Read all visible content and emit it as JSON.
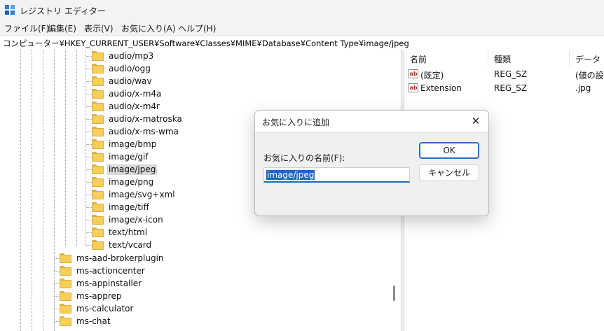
{
  "window": {
    "title": "レジストリ エディター",
    "icon": "registry-editor-icon"
  },
  "menu": [
    "ファイル(F)",
    "編集(E)",
    "表示(V)",
    "お気に入り(A)",
    "ヘルプ(H)"
  ],
  "address": "コンピューター¥HKEY_CURRENT_USER¥Software¥Classes¥MIME¥Database¥Content Type¥image/jpeg",
  "tree": {
    "content_type_children": [
      "audio/mp3",
      "audio/ogg",
      "audio/wav",
      "audio/x-m4a",
      "audio/x-m4r",
      "audio/x-matroska",
      "audio/x-ms-wma",
      "image/bmp",
      "image/gif",
      "image/jpeg",
      "image/png",
      "image/svg+xml",
      "image/tiff",
      "image/x-icon",
      "text/html",
      "text/vcard"
    ],
    "classes_children": [
      "ms-aad-brokerplugin",
      "ms-actioncenter",
      "ms-appinstaller",
      "ms-apprep",
      "ms-calculator",
      "ms-chat"
    ],
    "selected": "image/jpeg"
  },
  "values": {
    "headers": [
      "名前",
      "種類",
      "データ"
    ],
    "rows": [
      {
        "name": "(既定)",
        "type": "REG_SZ",
        "data": "(値の設"
      },
      {
        "name": "Extension",
        "type": "REG_SZ",
        "data": ".jpg"
      }
    ],
    "icon": "string-value-ab-icon"
  },
  "dialog": {
    "title": "お気に入りに追加",
    "close_symbol": "✕",
    "field_label": "お気に入りの名前(F):",
    "field_value": "image/jpeg",
    "ok_label": "OK",
    "cancel_label": "キャンセル"
  },
  "colors": {
    "accent": "#1f66c1",
    "folder": "#f6cf5b",
    "selection": "#d9d9d9"
  }
}
